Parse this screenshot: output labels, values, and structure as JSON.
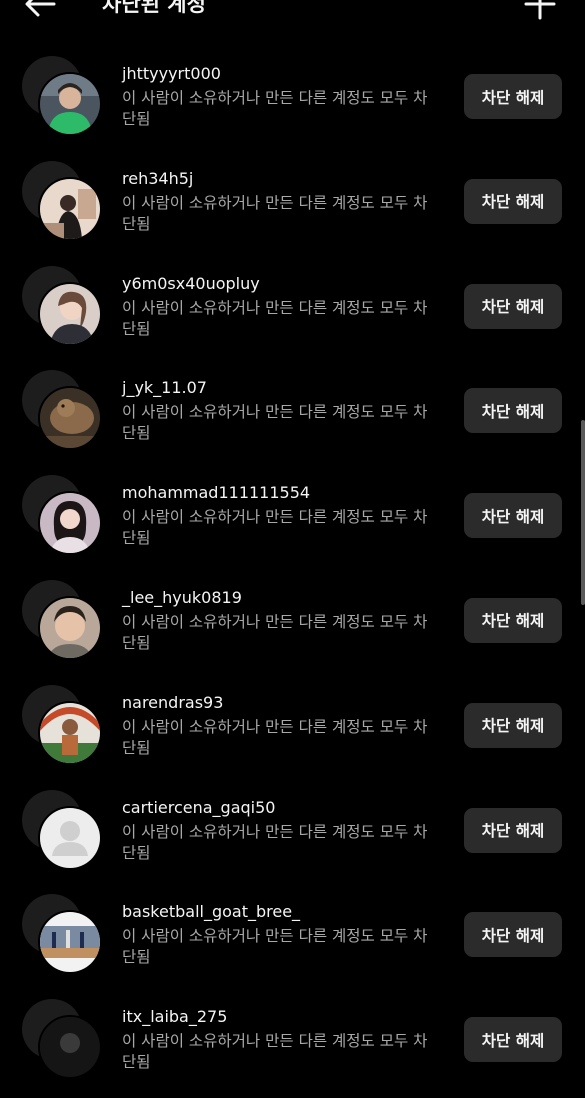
{
  "header": {
    "title": "차단된 계정"
  },
  "blocked_note": "이 사람이 소유하거나 만든 다른 계정도 모두 차단됨",
  "unblock_label": "차단 해제",
  "accounts": [
    {
      "username": "jhttyyyrt000"
    },
    {
      "username": "reh34h5j"
    },
    {
      "username": "y6m0sx40uopluy"
    },
    {
      "username": "j_yk_11.07"
    },
    {
      "username": "mohammad111111554"
    },
    {
      "username": "_lee_hyuk0819"
    },
    {
      "username": "narendras93"
    },
    {
      "username": "cartiercena_gaqi50"
    },
    {
      "username": "basketball_goat_bree_"
    },
    {
      "username": "itx_laiba_275"
    }
  ],
  "colors": {
    "background": "#000000",
    "button": "#2b2b2b",
    "secondary_text": "#a8a8a8"
  }
}
